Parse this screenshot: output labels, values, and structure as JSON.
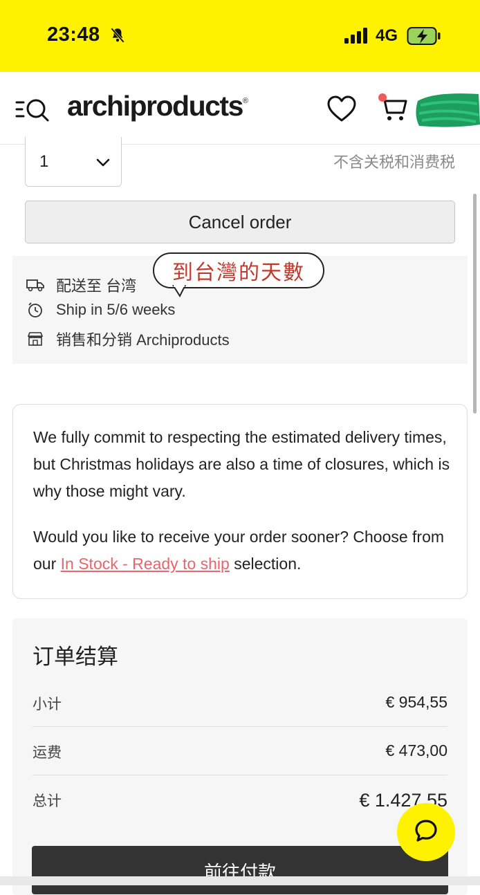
{
  "status_bar": {
    "time": "23:48",
    "network": "4G",
    "icons": [
      "bell-slash-icon",
      "signal-icon",
      "battery-charging-icon"
    ]
  },
  "header": {
    "logo_text": "archiproducts",
    "logo_mark": "®",
    "icons": [
      "menu-search-icon",
      "heart-icon",
      "cart-icon"
    ]
  },
  "order_item": {
    "quantity": "1",
    "tax_note": "不含关税和消费税",
    "cancel_label": "Cancel order"
  },
  "shipping": {
    "ship_to": "配送至 台湾",
    "ship_time": "Ship in 5/6 weeks",
    "seller": "销售和分销 Archiproducts",
    "annotation": "到台灣的天數"
  },
  "notice": {
    "paragraph1": "We fully commit to respecting the estimated delivery times, but Christmas holidays are also a time of closures, which is why those might vary.",
    "paragraph2_before": "Would you like to receive your order sooner? Choose from our ",
    "paragraph2_link": "In Stock - Ready to ship",
    "paragraph2_after": " selection."
  },
  "summary": {
    "title": "订单结算",
    "rows": [
      {
        "label": "小计",
        "value": "€ 954,55"
      },
      {
        "label": "运费",
        "value": "€ 473,00"
      },
      {
        "label": "总计",
        "value": "€ 1.427,55"
      }
    ],
    "pay_label": "前往付款"
  },
  "colors": {
    "accent_yellow": "#fef200",
    "link": "#e8656b",
    "annotation_red": "#c0392b",
    "pay_button": "#333333"
  }
}
